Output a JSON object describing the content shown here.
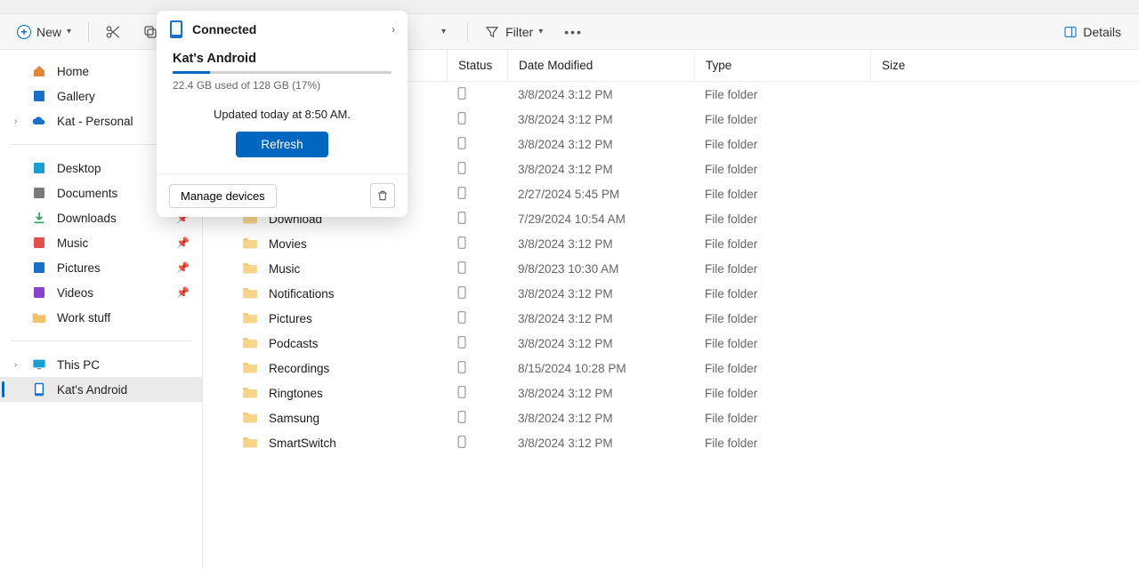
{
  "toolbar": {
    "new_label": "New",
    "filter_label": "Filter",
    "details_label": "Details"
  },
  "sidebar": {
    "groupA": [
      {
        "label": "Home",
        "icon": "home"
      },
      {
        "label": "Gallery",
        "icon": "gallery"
      },
      {
        "label": "Kat - Personal",
        "icon": "cloud",
        "expandable": true
      }
    ],
    "groupB": [
      {
        "label": "Desktop",
        "icon": "desktop",
        "pinned": true
      },
      {
        "label": "Documents",
        "icon": "documents",
        "pinned": true
      },
      {
        "label": "Downloads",
        "icon": "downloads",
        "pinned": true
      },
      {
        "label": "Music",
        "icon": "music",
        "pinned": true
      },
      {
        "label": "Pictures",
        "icon": "pictures",
        "pinned": true
      },
      {
        "label": "Videos",
        "icon": "videos",
        "pinned": true
      },
      {
        "label": "Work stuff",
        "icon": "folder"
      }
    ],
    "groupC": [
      {
        "label": "This PC",
        "icon": "thispc",
        "expandable": true
      },
      {
        "label": "Kat's Android",
        "icon": "phone",
        "active": true
      }
    ]
  },
  "columns": {
    "status": "Status",
    "date": "Date Modified",
    "type": "Type",
    "size": "Size"
  },
  "rows": [
    {
      "name": "",
      "date": "3/8/2024 3:12 PM",
      "type": "File folder"
    },
    {
      "name": "",
      "date": "3/8/2024 3:12 PM",
      "type": "File folder"
    },
    {
      "name": "",
      "date": "3/8/2024 3:12 PM",
      "type": "File folder"
    },
    {
      "name": "",
      "date": "3/8/2024 3:12 PM",
      "type": "File folder"
    },
    {
      "name": "",
      "date": "2/27/2024 5:45 PM",
      "type": "File folder"
    },
    {
      "name": "Download",
      "date": "7/29/2024 10:54 AM",
      "type": "File folder"
    },
    {
      "name": "Movies",
      "date": "3/8/2024 3:12 PM",
      "type": "File folder"
    },
    {
      "name": "Music",
      "date": "9/8/2023 10:30 AM",
      "type": "File folder"
    },
    {
      "name": "Notifications",
      "date": "3/8/2024 3:12 PM",
      "type": "File folder"
    },
    {
      "name": "Pictures",
      "date": "3/8/2024 3:12 PM",
      "type": "File folder"
    },
    {
      "name": "Podcasts",
      "date": "3/8/2024 3:12 PM",
      "type": "File folder"
    },
    {
      "name": "Recordings",
      "date": "8/15/2024 10:28 PM",
      "type": "File folder"
    },
    {
      "name": "Ringtones",
      "date": "3/8/2024 3:12 PM",
      "type": "File folder"
    },
    {
      "name": "Samsung",
      "date": "3/8/2024 3:12 PM",
      "type": "File folder"
    },
    {
      "name": "SmartSwitch",
      "date": "3/8/2024 3:12 PM",
      "type": "File folder"
    }
  ],
  "popup": {
    "status": "Connected",
    "device": "Kat's Android",
    "storage": "22.4 GB used of 128 GB (17%)",
    "storage_pct": 17,
    "updated": "Updated today at 8:50 AM.",
    "refresh": "Refresh",
    "manage": "Manage devices"
  }
}
